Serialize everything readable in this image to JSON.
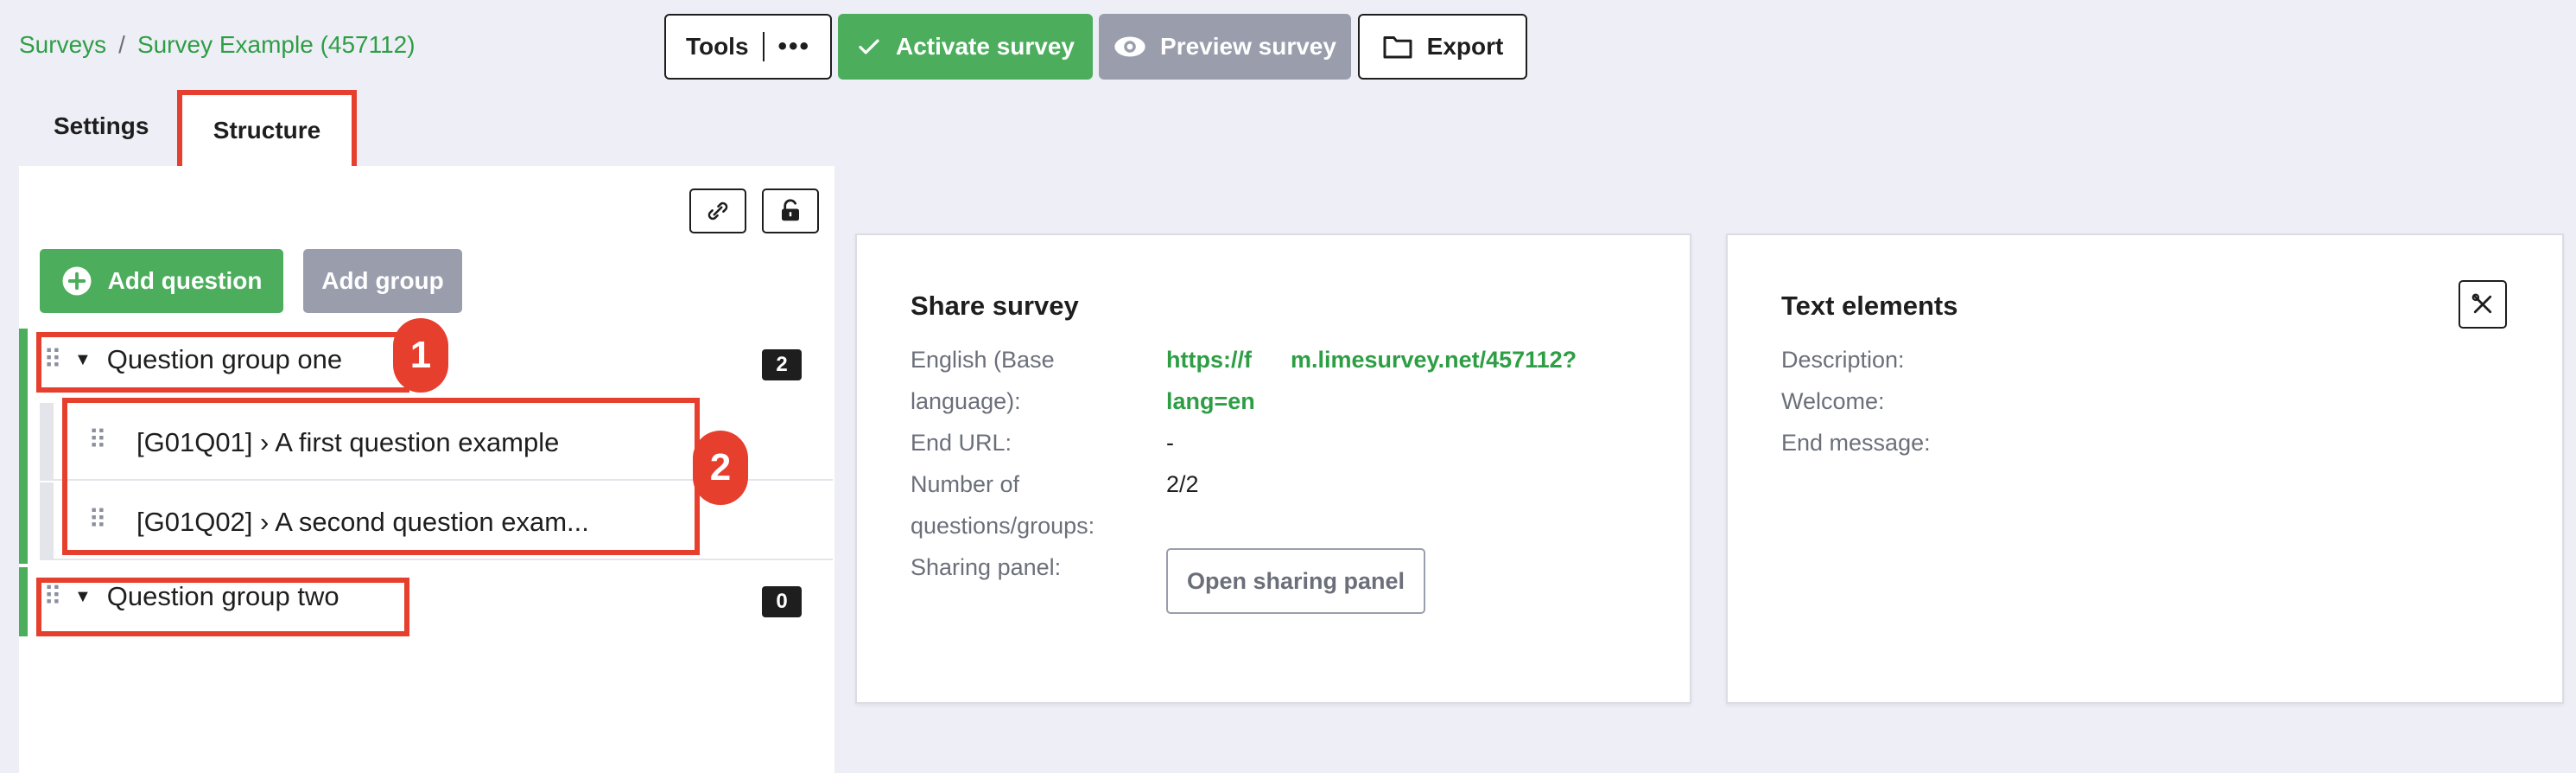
{
  "breadcrumb": {
    "root": "Surveys",
    "separator": "/",
    "current": "Survey Example (457112)"
  },
  "toolbar": {
    "tools_label": "Tools",
    "tools_more_icon": "ellipsis-icon",
    "activate_label": "Activate survey",
    "activate_icon": "check-icon",
    "preview_label": "Preview survey",
    "preview_icon": "eye-icon",
    "export_label": "Export",
    "export_icon": "folder-icon"
  },
  "tabs": [
    {
      "label": "Settings"
    },
    {
      "label": "Structure",
      "active": true
    }
  ],
  "structure": {
    "toolbar_icons": [
      "link-sync-icon",
      "unlock-icon"
    ],
    "add_question_label": "Add question",
    "add_group_label": "Add group",
    "groups": [
      {
        "name": "Question group one",
        "count": "2",
        "questions": [
          {
            "label": "[G01Q01] › A first question example"
          },
          {
            "label": "[G01Q02] › A second question exam..."
          }
        ]
      },
      {
        "name": "Question group two",
        "count": "0",
        "questions": []
      }
    ]
  },
  "annotations": {
    "marker_1": "1",
    "marker_2": "2"
  },
  "share_survey": {
    "title": "Share survey",
    "language_label_line1": "English (Base",
    "language_label_line2": "language):",
    "url_line1": "https://f      m.limesurvey.net/457112?",
    "url_line2": "lang=en",
    "end_url_label": "End URL:",
    "end_url_value": "-",
    "count_label_line1": "Number of",
    "count_label_line2": "questions/groups:",
    "count_value": "2/2",
    "sharing_panel_label": "Sharing panel:",
    "open_sharing_label": "Open sharing panel"
  },
  "text_elements": {
    "title": "Text elements",
    "description_label": "Description:",
    "welcome_label": "Welcome:",
    "end_message_label": "End message:",
    "tools_icon": "tools-icon"
  },
  "colors": {
    "accent_green": "#4cae5c",
    "annotation_red": "#e63f2d",
    "muted_gray": "#9a9eac"
  }
}
